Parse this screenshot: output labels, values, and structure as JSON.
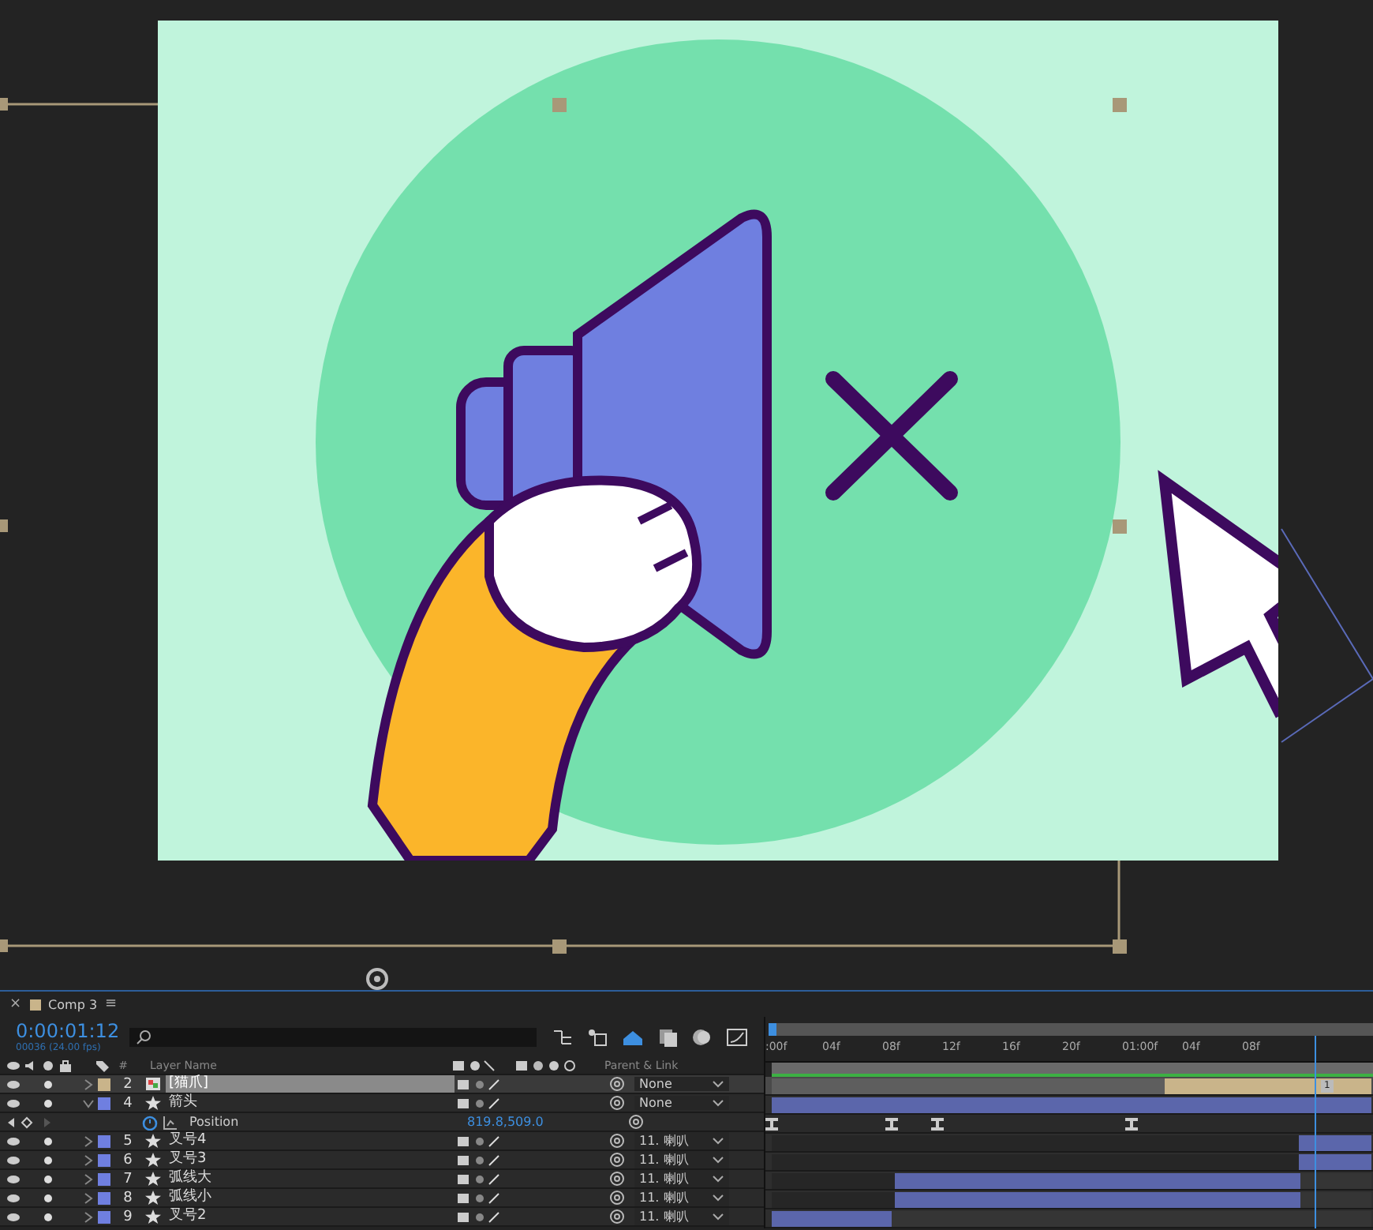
{
  "viewer": {
    "kind": "composition"
  },
  "timeline": {
    "tab": "Comp 3",
    "close": "×",
    "menu": "≡",
    "current_time": "0:00:01:12",
    "frame_info": "00036 (24.00 fps)",
    "headers": {
      "number": "#",
      "layer_name": "Layer Name",
      "parent": "Parent & Link"
    },
    "ruler": [
      ":00f",
      "04f",
      "08f",
      "12f",
      "16f",
      "20f",
      "01:00f",
      "04f",
      "08f"
    ],
    "marker": "1",
    "layers": [
      {
        "kind": "footage",
        "number": "2",
        "name": "[猫爪]",
        "color": "#c9b48a",
        "selected": true,
        "expanded": false,
        "parent": "None",
        "track": [
          {
            "kind": "gap",
            "level": 0.655
          },
          {
            "kind": "bar",
            "level": 1
          }
        ]
      },
      {
        "kind": "shape",
        "number": "4",
        "name": "箭头",
        "color": "#6f7fe0",
        "selected": false,
        "expanded": true,
        "parent": "None",
        "track": [
          {
            "kind": "bar",
            "level": 1
          }
        ]
      },
      {
        "kind": "property",
        "name": "Position",
        "value": "819.8,509.0",
        "keyframes": [
          {
            "level": 0
          },
          {
            "level": 0.2
          },
          {
            "level": 0.275
          },
          {
            "level": 0.6
          }
        ]
      },
      {
        "kind": "shape",
        "number": "5",
        "name": "叉号4",
        "color": "#6f7fe0",
        "selected": false,
        "expanded": false,
        "parent": "11. 喇叭",
        "track": [
          {
            "kind": "gap",
            "level": 0.88
          },
          {
            "kind": "bar",
            "level": 1
          }
        ]
      },
      {
        "kind": "shape",
        "number": "6",
        "name": "叉号3",
        "color": "#6f7fe0",
        "selected": false,
        "expanded": false,
        "parent": "11. 喇叭",
        "track": [
          {
            "kind": "gap",
            "level": 0.88
          },
          {
            "kind": "bar",
            "level": 1
          }
        ]
      },
      {
        "kind": "shape",
        "number": "7",
        "name": "弧线大",
        "color": "#6f7fe0",
        "selected": false,
        "expanded": false,
        "parent": "11. 喇叭",
        "track": [
          {
            "kind": "gap",
            "level": 0.205
          },
          {
            "kind": "bar",
            "level": 0.85
          }
        ]
      },
      {
        "kind": "shape",
        "number": "8",
        "name": "弧线小",
        "color": "#6f7fe0",
        "selected": false,
        "expanded": false,
        "parent": "11. 喇叭",
        "track": [
          {
            "kind": "gap",
            "level": 0.205
          },
          {
            "kind": "bar",
            "level": 0.85
          }
        ]
      },
      {
        "kind": "shape",
        "number": "9",
        "name": "叉号2",
        "color": "#6f7fe0",
        "selected": false,
        "expanded": false,
        "parent": "11. 喇叭",
        "track": [
          {
            "kind": "bar",
            "level": 0.2
          }
        ]
      }
    ]
  }
}
